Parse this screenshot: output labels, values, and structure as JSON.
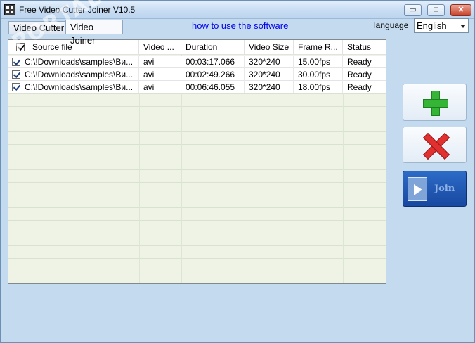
{
  "window": {
    "title": "Free Video Cutter Joiner V10.5"
  },
  "window_controls": {
    "minimize": "▭",
    "maximize": "□",
    "close": "✕"
  },
  "tabs": [
    {
      "label": "Video Cutter",
      "selected": false
    },
    {
      "label": "Video Joiner",
      "selected": true
    }
  ],
  "help_link": "how to use the software",
  "language": {
    "label": "language",
    "selected": "English"
  },
  "table": {
    "columns": [
      "Source file",
      "Video ...",
      "Duration",
      "Video Size",
      "Frame R...",
      "Status"
    ],
    "rows": [
      {
        "checked": true,
        "file": "C:\\!Downloads\\samples\\Ви...",
        "format": "avi",
        "duration": "00:03:17.066",
        "size": "320*240",
        "frame_rate": "15.00fps",
        "status": "Ready"
      },
      {
        "checked": true,
        "file": "C:\\!Downloads\\samples\\Ви...",
        "format": "avi",
        "duration": "00:02:49.266",
        "size": "320*240",
        "frame_rate": "30.00fps",
        "status": "Ready"
      },
      {
        "checked": true,
        "file": "C:\\!Downloads\\samples\\Ви...",
        "format": "avi",
        "duration": "00:06:46.055",
        "size": "320*240",
        "frame_rate": "18.00fps",
        "status": "Ready"
      }
    ]
  },
  "actions": {
    "add_icon": "plus-icon",
    "remove_icon": "close-icon",
    "join_label": "Join"
  },
  "watermark": "PORTAL",
  "colors": {
    "accent": "#1848a0",
    "add": "#35b535",
    "remove": "#e03030",
    "grid_bg": "#eef3e6"
  }
}
